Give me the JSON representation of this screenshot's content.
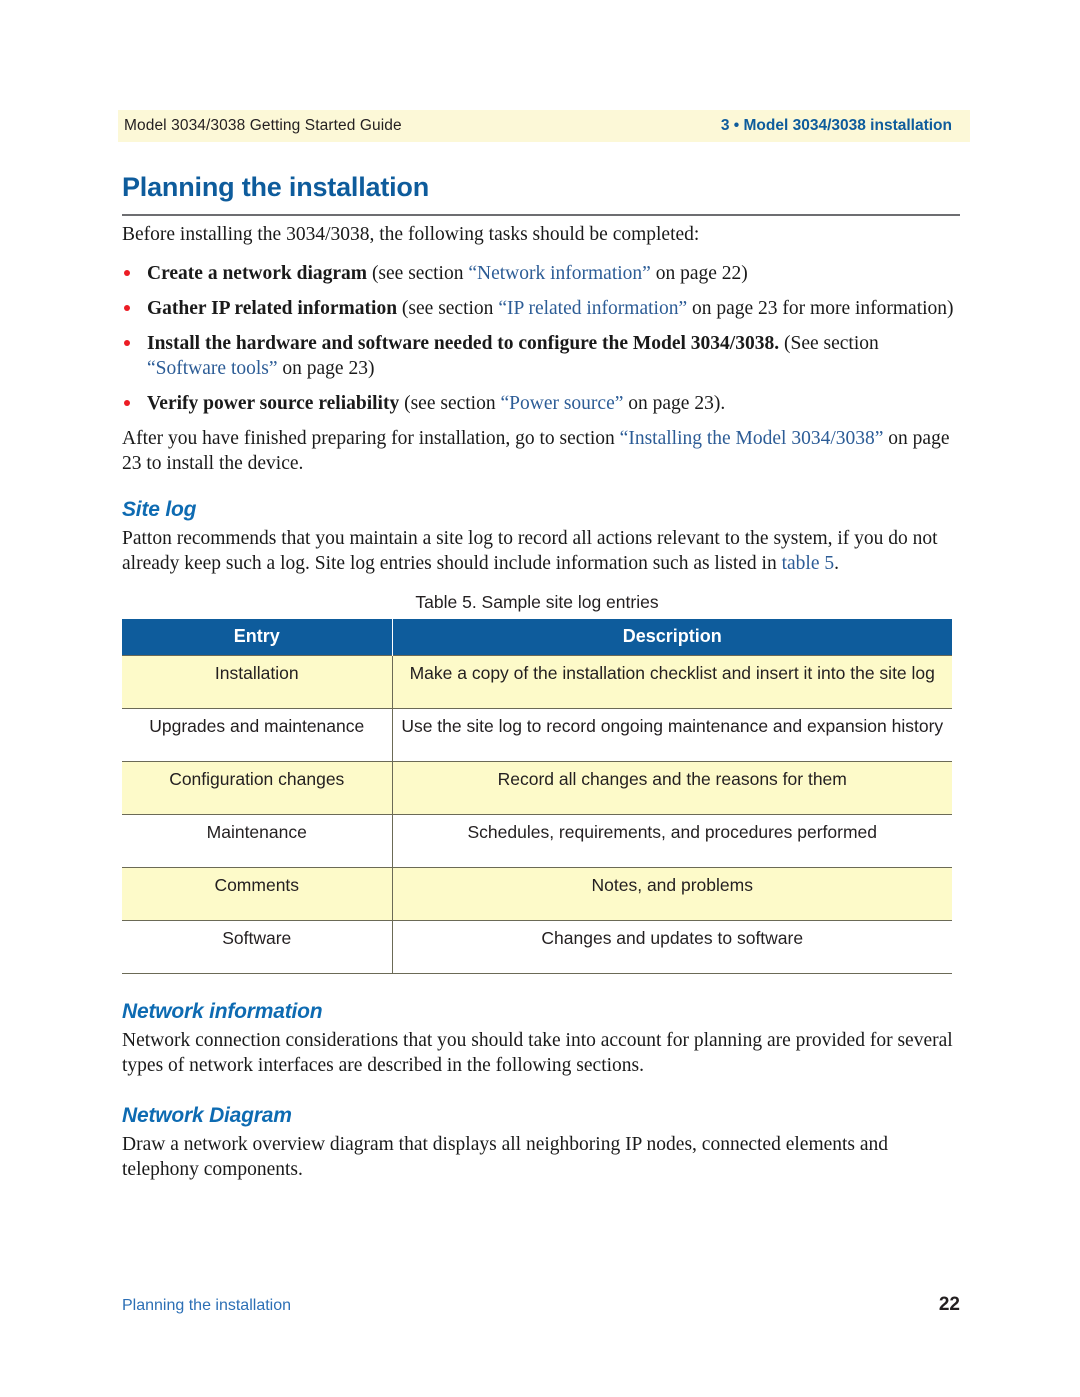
{
  "header": {
    "left_text": "Model 3034/3038 Getting Started Guide",
    "right_text": "3 • Model 3034/3038 installation",
    "band_color": "#fcf8d7",
    "accent_color": "#0e5c9c"
  },
  "chapter": {
    "title": "Planning the installation"
  },
  "intro": {
    "paragraph": "Before installing the 3034/3038, the following tasks should be completed:"
  },
  "tasks": [
    {
      "lead": "Create a network diagram",
      "mid": " (see section ",
      "xref": "“Network information”",
      "tail": " on page 22)",
      "tail2": "",
      "xref2": ""
    },
    {
      "lead": "Gather IP related information",
      "mid": " (see section ",
      "xref": "“IP related information”",
      "tail": " on page 23 for more information)",
      "tail2": "",
      "xref2": ""
    },
    {
      "lead": "Install the hardware and software needed to configure the Model 3034/3038.",
      "mid": " (See section ",
      "xref": "“Software",
      "tail": "",
      "xref2": "tools”",
      "tail2": " on page 23)"
    },
    {
      "lead": "Verify power source reliability",
      "mid": " (see section ",
      "xref": "“Power source”",
      "tail": " on page 23).",
      "tail2": "",
      "xref2": ""
    }
  ],
  "after_intro": {
    "part1": "After you have finished preparing for installation, go to section ",
    "xref": "“Installing the Model 3034/3038”",
    "part2": " on page 23 to install the device."
  },
  "site_log": {
    "heading": "Site log",
    "paragraph_part1": "Patton recommends that you maintain a site log to record all actions relevant to the system, if you do not already keep such a log. Site log entries should include information such as listed in ",
    "paragraph_xref": "table 5",
    "paragraph_part2": "."
  },
  "table": {
    "caption": "Table 5. Sample site log entries",
    "header_bg": "#0e5c9c",
    "shade_bg": "#fdfac9",
    "columns": [
      "Entry",
      "Description"
    ],
    "rows": [
      {
        "entry": "Installation",
        "description": "Make a copy of the installation checklist and insert it into the site log",
        "shaded": true
      },
      {
        "entry": "Upgrades and maintenance",
        "description": "Use the site log to record ongoing maintenance and expansion history",
        "shaded": false
      },
      {
        "entry": "Configuration changes",
        "description": "Record all changes and the reasons for them",
        "shaded": true
      },
      {
        "entry": "Maintenance",
        "description": "Schedules, requirements, and procedures performed",
        "shaded": false
      },
      {
        "entry": "Comments",
        "description": "Notes, and problems",
        "shaded": true
      },
      {
        "entry": "Software",
        "description": "Changes and updates to software",
        "shaded": false
      }
    ]
  },
  "network_information": {
    "heading": "Network information",
    "paragraph": "Network connection considerations that you should take into account for planning are provided for several types of network interfaces are described in the following sections."
  },
  "network_diagram": {
    "heading": "Network Diagram",
    "paragraph": "Draw a network overview diagram that displays all neighboring IP nodes, connected elements and telephony components."
  },
  "footer": {
    "left_text": "Planning the installation",
    "page_number": "22"
  }
}
